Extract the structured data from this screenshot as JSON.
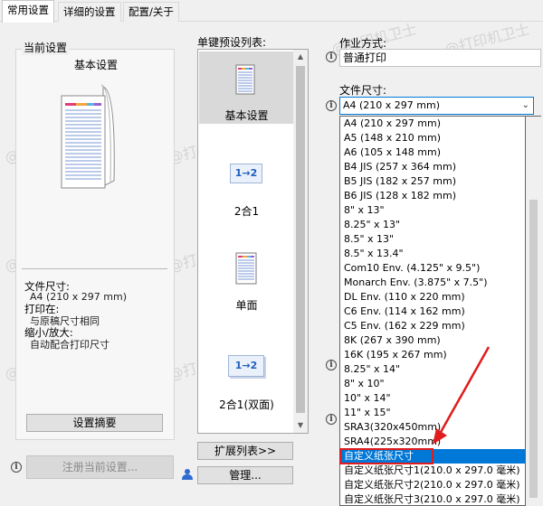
{
  "tabs": [
    {
      "label": "常用设置"
    },
    {
      "label": "详细的设置"
    },
    {
      "label": "配置/关于"
    }
  ],
  "watermark": "@打印机卫士",
  "current": {
    "section_title": "当前设置",
    "preset_name": "基本设置",
    "paper_size_label": "文件尺寸:",
    "paper_size_value": "A4 (210 x 297 mm)",
    "print_on_label": "打印在:",
    "print_on_value": "与原稿尺寸相同",
    "scale_label": "缩小/放大:",
    "scale_value": "自动配合打印尺寸",
    "summary_button": "设置摘要",
    "register_button": "注册当前设置..."
  },
  "presets": {
    "title": "单键预设列表:",
    "items": [
      {
        "label": "基本设置",
        "icon_text": ""
      },
      {
        "label": "2合1",
        "icon_text": "1→2"
      },
      {
        "label": "单面",
        "icon_text": ""
      },
      {
        "label": "2合1(双面)",
        "icon_text": "1→2"
      }
    ],
    "expand_button": "扩展列表>>",
    "manage_button": "管理..."
  },
  "job": {
    "label": "作业方式:",
    "value": "普通打印"
  },
  "paper": {
    "label": "文件尺寸:",
    "value": "A4 (210 x 297 mm)",
    "options": [
      "A4 (210 x 297 mm)",
      "A5 (148 x 210 mm)",
      "A6 (105 x 148 mm)",
      "B4 JIS (257 x 364 mm)",
      "B5 JIS (182 x 257 mm)",
      "B6 JIS (128 x 182 mm)",
      "8\" x 13\"",
      "8.25\" x 13\"",
      "8.5\" x 13\"",
      "8.5\" x 13.4\"",
      "Com10 Env. (4.125\" x 9.5\")",
      "Monarch Env. (3.875\" x 7.5\")",
      "DL Env. (110 x 220 mm)",
      "C6 Env. (114 x 162 mm)",
      "C5 Env. (162 x 229 mm)",
      "8K (267 x 390 mm)",
      "16K (195 x 267 mm)",
      "8.25\" x 14\"",
      "8\" x 10\"",
      "10\" x 14\"",
      "11\" x 15\"",
      "SRA3(320x450mm)",
      "SRA4(225x320mm)",
      "自定义纸张尺寸",
      "自定义纸张尺寸1(210.0 x 297.0 毫米)",
      "自定义纸张尺寸2(210.0 x 297.0 毫米)",
      "自定义纸张尺寸3(210.0 x 297.0 毫米)"
    ],
    "highlighted_index": 23
  },
  "colors": {
    "highlight": "#0078d7",
    "annotation": "#e01c1c"
  }
}
